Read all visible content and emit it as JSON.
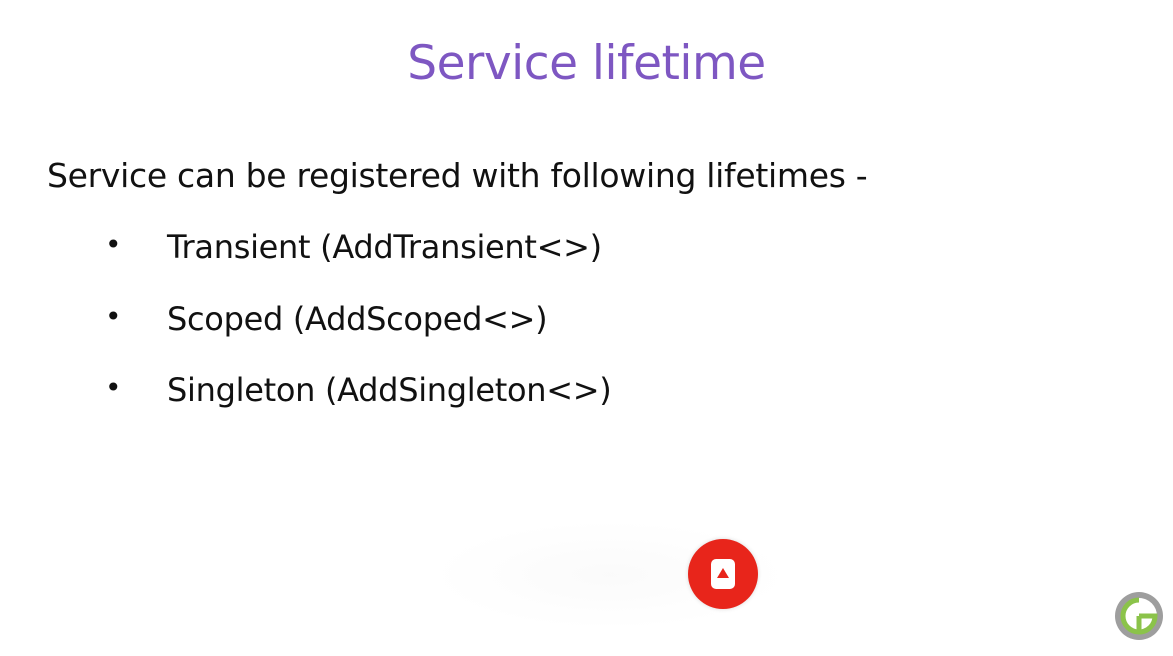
{
  "slide": {
    "title": "Service lifetime",
    "intro": "Service can be registered with following lifetimes -",
    "bullets": [
      {
        "marker": "•",
        "label": "Transient (AddTransient<>)"
      },
      {
        "marker": "•",
        "label": "Scoped (AddScoped<>)"
      },
      {
        "marker": "•",
        "label": "Singleton (AddSingleton<>)"
      }
    ]
  },
  "overlay": {
    "play_button_icon": "play-button-icon",
    "channel_logo_icon": "channel-logo-icon"
  },
  "colors": {
    "title": "#7e57c2",
    "text": "#111111",
    "play_button": "#e8251b",
    "logo_gray": "#9e9e9e",
    "logo_green": "#8bc34a"
  }
}
